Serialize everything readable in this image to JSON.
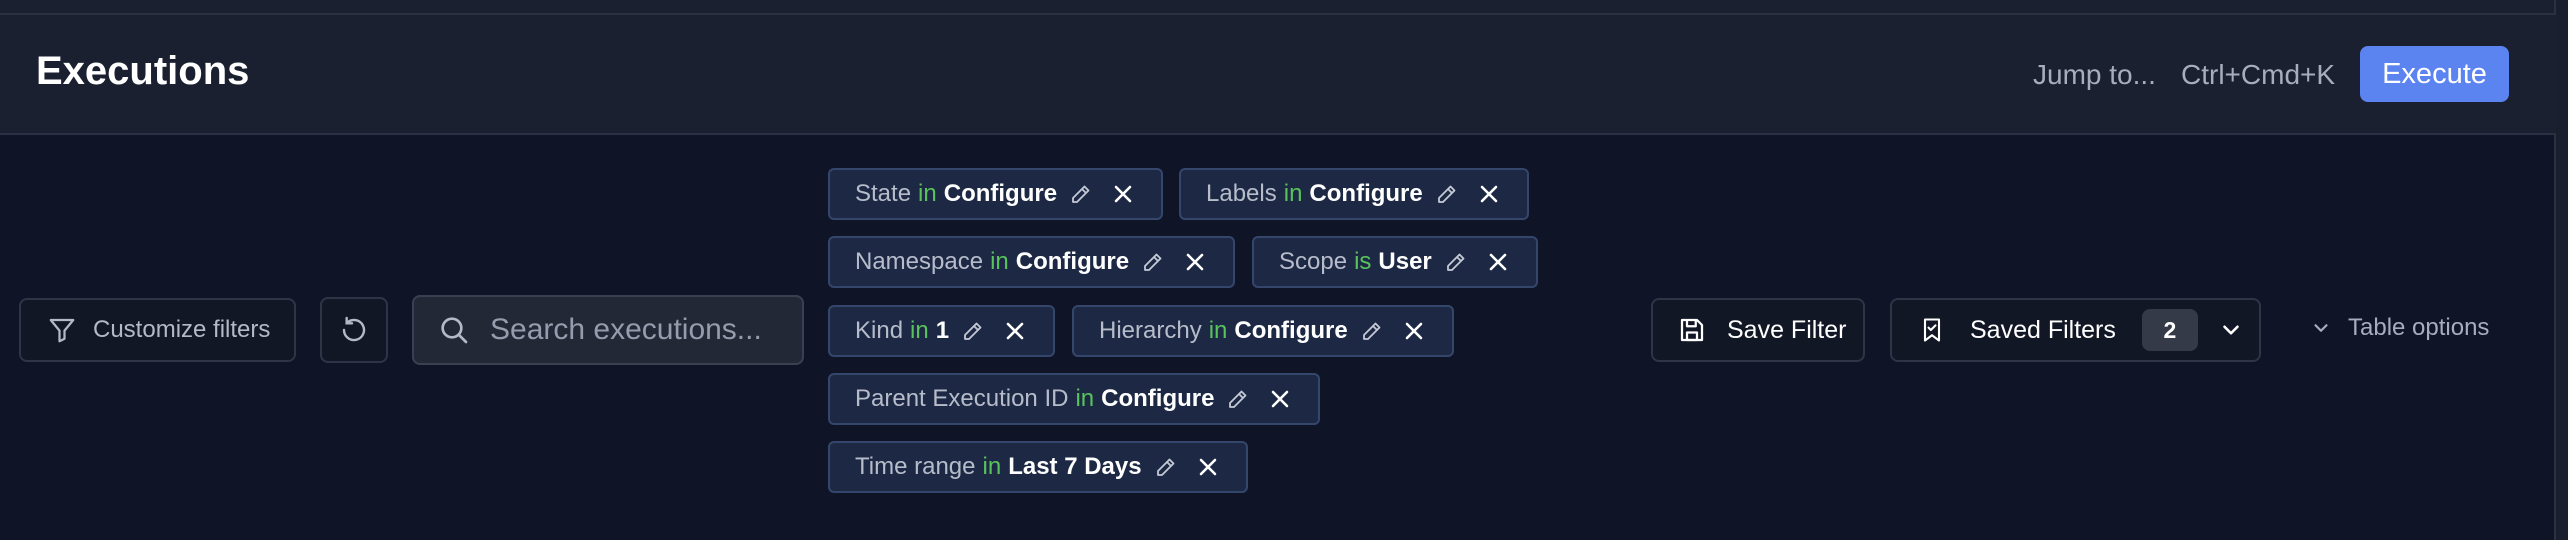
{
  "header": {
    "title": "Executions",
    "jump_label": "Jump to...",
    "shortcut": "Ctrl+Cmd+K",
    "execute_label": "Execute"
  },
  "toolbar": {
    "customize_label": "Customize filters",
    "search_placeholder": "Search executions...",
    "save_filter_label": "Save Filter",
    "saved_filters_label": "Saved Filters",
    "saved_filters_count": "2",
    "table_options_label": "Table options"
  },
  "filters": [
    {
      "field": "State",
      "op": "in",
      "value": "Configure"
    },
    {
      "field": "Labels",
      "op": "in",
      "value": "Configure"
    },
    {
      "field": "Namespace",
      "op": "in",
      "value": "Configure"
    },
    {
      "field": "Scope",
      "op": "is",
      "value": "User"
    },
    {
      "field": "Kind",
      "op": "in",
      "value": "1"
    },
    {
      "field": "Hierarchy",
      "op": "in",
      "value": "Configure"
    },
    {
      "field": "Parent Execution ID",
      "op": "in",
      "value": "Configure"
    },
    {
      "field": "Time range",
      "op": "in",
      "value": "Last 7 Days"
    }
  ],
  "colors": {
    "background": "#0f1426",
    "header": "#1b2030",
    "accent": "#5b84f1",
    "operator": "#58c25b",
    "chip": "#1d2944"
  },
  "icons": [
    "filter-icon",
    "refresh-icon",
    "search-icon",
    "pencil-icon",
    "close-icon",
    "save-icon",
    "bookmark-icon",
    "chevron-down-icon"
  ]
}
